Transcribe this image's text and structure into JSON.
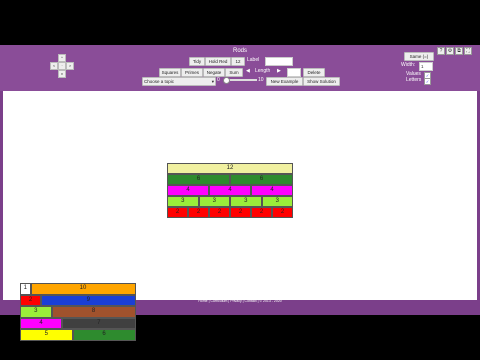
{
  "header": {
    "title": "Rods",
    "buttons": {
      "tidy": "Tidy",
      "hold_red": "Hold Red",
      "value": "12",
      "label": "Label",
      "squares": "Squares",
      "primes": "Primes",
      "neg": "Negate",
      "sum": "Sum",
      "length": "Length",
      "length_val": "",
      "delete": "Delete",
      "choose": "Choose a topic",
      "min": "0",
      "max": "10",
      "new_example": "New Example",
      "show_solution": "Show Solution"
    },
    "right": {
      "same": "Same (=)",
      "width_label": "Width:",
      "width_val": "1",
      "values_label": "Values",
      "letters_label": "Letters",
      "values_checked": "✓",
      "letters_checked": "✓"
    },
    "pad": {
      "up": "^",
      "left": "<",
      "center": "·",
      "right": ">",
      "down": "v"
    },
    "icons": {
      "help": "?",
      "settings": "⚙",
      "copy": "⧉",
      "fullscreen": "⛶"
    }
  },
  "grid": {
    "rows": [
      {
        "color": "#f0f0a0",
        "cells": [
          "12"
        ]
      },
      {
        "color": "#2e8b2e",
        "cells": [
          "6",
          "6"
        ]
      },
      {
        "color": "#ff00ff",
        "cells": [
          "4",
          "4",
          "4"
        ]
      },
      {
        "color": "#9aed3a",
        "cells": [
          "3",
          "3",
          "3",
          "3"
        ]
      },
      {
        "color": "#ff0000",
        "cells": [
          "2",
          "2",
          "2",
          "2",
          "2",
          "2"
        ]
      }
    ]
  },
  "stack": {
    "rows": [
      {
        "cells": [
          {
            "v": "1",
            "c": "#ffffff",
            "f": 1
          },
          {
            "v": "10",
            "c": "#ffa500",
            "f": 10
          }
        ]
      },
      {
        "cells": [
          {
            "v": "2",
            "c": "#ff0000",
            "f": 2
          },
          {
            "v": "9",
            "c": "#1a3fd6",
            "f": 9
          }
        ]
      },
      {
        "cells": [
          {
            "v": "3",
            "c": "#9aed3a",
            "f": 3
          },
          {
            "v": "8",
            "c": "#a0522d",
            "f": 8
          }
        ]
      },
      {
        "cells": [
          {
            "v": "4",
            "c": "#ff00ff",
            "f": 4
          },
          {
            "v": "7",
            "c": "#404040",
            "f": 7
          }
        ]
      },
      {
        "cells": [
          {
            "v": "5",
            "c": "#ffff00",
            "f": 5
          },
          {
            "v": "6",
            "c": "#2e8b2e",
            "f": 6
          }
        ]
      }
    ]
  },
  "footer": {
    "text": "Home | Curriculum | Privacy | Contact | © 2013 - 2020"
  }
}
